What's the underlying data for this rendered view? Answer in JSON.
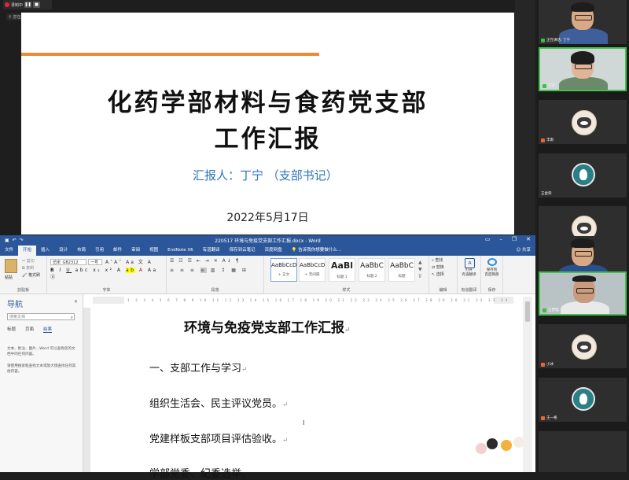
{
  "recorder": {
    "status": "录制中"
  },
  "screen_share": {
    "label": "您在屏幕"
  },
  "slide": {
    "title_line1": "化药学部材料与食药党支部",
    "title_line2": "工作汇报",
    "reporter": "汇报人：丁宁 （支部书记）",
    "date": "2022年5月17日"
  },
  "participants": [
    {
      "name": "正在讲话: 丁宁",
      "speaking": true
    },
    {
      "name": "丁宁",
      "speaking": false
    },
    {
      "name": "丰雨",
      "speaking": false
    },
    {
      "name": "王金荣",
      "speaking": false
    },
    {
      "name": "",
      "speaking": false
    },
    {
      "name": "冯朗",
      "speaking": false
    },
    {
      "name": "王梦瑞",
      "speaking": false
    },
    {
      "name": "小冰",
      "speaking": false
    },
    {
      "name": "王一格",
      "speaking": false
    }
  ],
  "word": {
    "window_title": "220517 环境与免疫党支部工作汇报.docx - Word",
    "tabs": [
      "文件",
      "开始",
      "插入",
      "设计",
      "布局",
      "引用",
      "邮件",
      "审阅",
      "视图",
      "EndNote X6",
      "有道翻译",
      "保存到云笔记",
      "百度网盘"
    ],
    "tell_me": "告诉我你想要做什么...",
    "share": "共享",
    "ribbon": {
      "clipboard": {
        "paste": "粘贴",
        "cut": "剪切",
        "copy": "复制",
        "format_painter": "格式刷",
        "group": "剪贴板"
      },
      "font": {
        "font_name": "仿宋_GB2312",
        "font_size": "一号",
        "group": "字体"
      },
      "paragraph": {
        "group": "段落"
      },
      "styles": {
        "items": [
          {
            "sample": "AaBbCcDc",
            "name": "+ 正文"
          },
          {
            "sample": "AaBbCcDc",
            "name": "+ 无间隔"
          },
          {
            "sample": "AaBl",
            "name": "标题 1"
          },
          {
            "sample": "AaBbC",
            "name": "标题 2"
          },
          {
            "sample": "AaBbC",
            "name": "标题"
          }
        ],
        "group": "样式"
      },
      "editing": {
        "find": "查找",
        "replace": "替换",
        "select": "选择",
        "group": "编辑"
      },
      "youdao": {
        "label": "打开\n有道翻译",
        "group": "有道翻译"
      },
      "baidu": {
        "label": "保存到\n百度网盘",
        "group": "保存"
      }
    },
    "nav": {
      "title": "导航",
      "search_placeholder": "搜索文档",
      "tabs": [
        "标题",
        "页面",
        "结果"
      ],
      "help1": "文本、批注、图片...Word 可以查找您的文档中的任何内容。",
      "help2": "请使用搜索框查找文本或放大镜查找任何其他内容。"
    },
    "doc": {
      "title": "环境与免疫党支部工作汇报",
      "lines": [
        "一、支部工作与学习",
        "组织生活会、民主评议党员。",
        "党建样板支部项目评估验收。",
        "学部党委、纪委选举。"
      ]
    }
  }
}
